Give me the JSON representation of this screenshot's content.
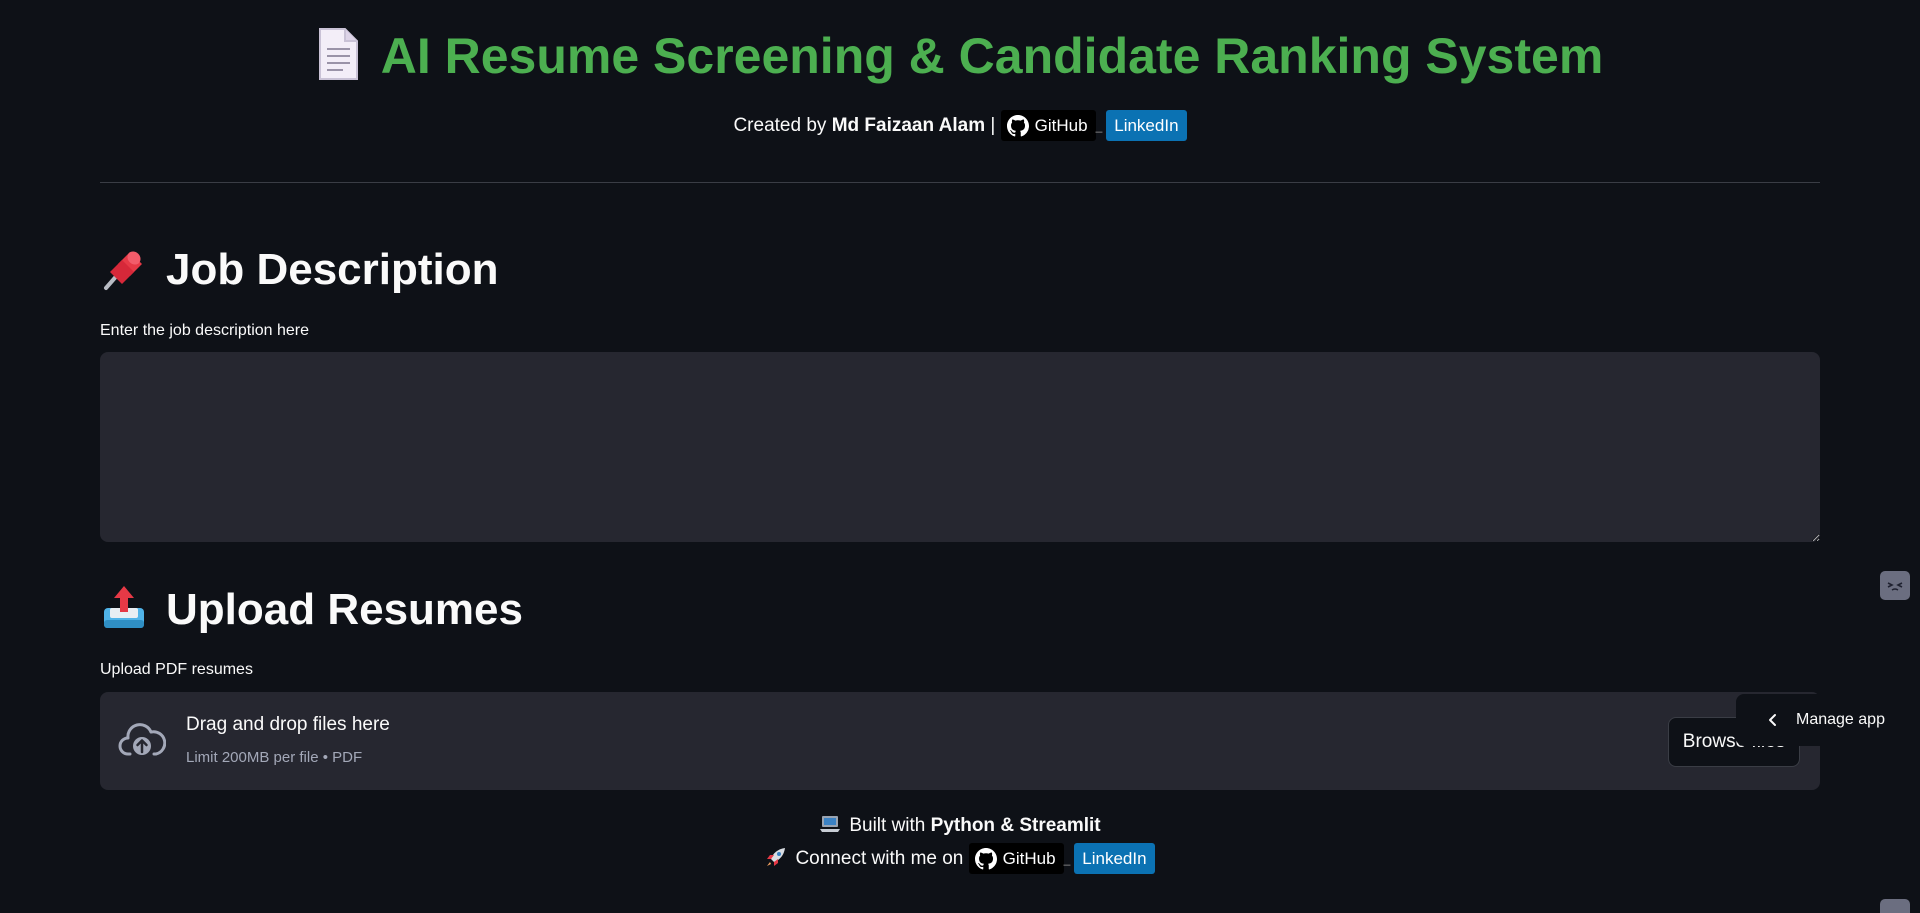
{
  "header": {
    "title": "AI Resume Screening & Candidate Ranking System",
    "title_icon": "document-icon",
    "title_color": "#4caf50",
    "created_by_prefix": "Created by",
    "author": "Md Faizaan Alam",
    "separator": "|",
    "github_label": "GitHub",
    "linkedin_label": "LinkedIn"
  },
  "job_description": {
    "heading": "Job Description",
    "heading_icon": "pushpin-icon",
    "label": "Enter the job description here",
    "value": ""
  },
  "upload": {
    "heading": "Upload Resumes",
    "heading_icon": "outbox-tray-icon",
    "label": "Upload PDF resumes",
    "dropzone_title": "Drag and drop files here",
    "dropzone_subtitle": "Limit 200MB per file • PDF",
    "browse_label": "Browse files"
  },
  "footer": {
    "built_prefix": "Built with",
    "built_tech": "Python & Streamlit",
    "connect_text": "Connect with me on",
    "github_label": "GitHub",
    "linkedin_label": "LinkedIn",
    "built_icon": "laptop-icon",
    "connect_icon": "rocket-icon"
  },
  "manage_app": {
    "label": "Manage app"
  },
  "colors": {
    "background": "#0e1117",
    "input_bg": "#262730",
    "accent_green": "#4caf50",
    "linkedin_blue": "#0b72b3"
  }
}
